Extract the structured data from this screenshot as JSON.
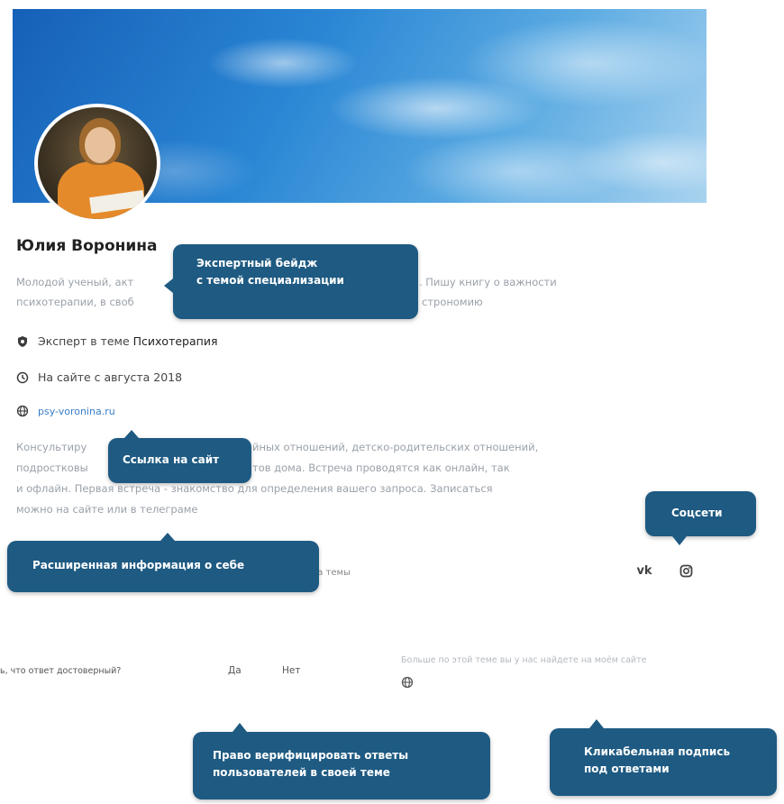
{
  "profile": {
    "name": "Юлия Воронина",
    "bio_line1": "Молодой ученый, акт",
    "bio_line1_right": "ии. Пишу книгу о важности",
    "bio_line2": "психотерапии, в своб",
    "bio_line2_right": "строномию",
    "expert_prefix": "Эксперт в теме",
    "expert_topic": "Психотерапия",
    "since": "На сайте с августа 2018",
    "website": "psy-voronina.ru",
    "about_line1_left": "Консультиру",
    "about_line1_right": "йных отношений, детско-родительских отношений,",
    "about_line2_left": "подростковы",
    "about_line2_right": "тов дома. Встреча проводятся как онлайн, так",
    "about_line3": "и офлайн. Первая встреча - знакомство для определения вашего запроса. Записаться",
    "about_line4": "можно на сайте или в телеграме",
    "topics_partial": "ся на темы"
  },
  "social": {
    "vk": "vk",
    "instagram": "instagram-icon"
  },
  "verification": {
    "question": "ь, что ответ достоверный?",
    "yes": "Да",
    "no": "Нет",
    "more_text": "Больше по этой теме вы у нас найдете на моём сайте"
  },
  "callouts": {
    "badge_line1": "Экспертный бейдж",
    "badge_line2": "с темой специализации",
    "site_link": "Ссылка на сайт",
    "socials": "Соцсети",
    "extended_info": "Расширенная информация о себе",
    "verify_line1": "Право верифицировать ответы",
    "verify_line2": "пользователей в своей теме",
    "clickable_line1": "Кликабельная подпись",
    "clickable_line2": "под ответами"
  },
  "colors": {
    "callout_bg": "#1e5a82",
    "link": "#3a7ec9",
    "muted_text": "#9aa1a9"
  }
}
